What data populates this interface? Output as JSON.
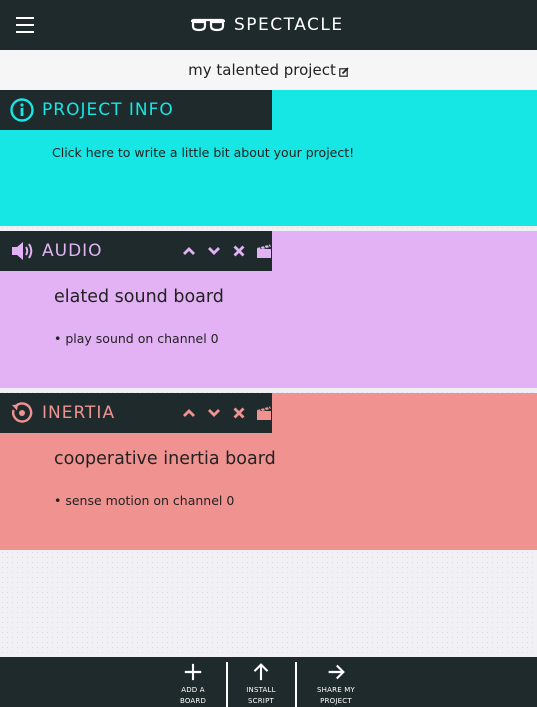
{
  "header": {
    "menu_icon": "hamburger-menu-icon",
    "logo_icon": "spectacles-logo-icon",
    "brand": "SPECTACLE"
  },
  "project": {
    "title": "my talented project",
    "edit_icon": "edit-pencil-icon"
  },
  "info": {
    "icon": "info-circle-icon",
    "title": "PROJECT INFO",
    "placeholder": "Click here to write a little bit about your project!"
  },
  "boards": [
    {
      "type": "AUDIO",
      "icon": "speaker-icon",
      "name": "elated sound board",
      "line": "• play sound on channel 0",
      "color": "#e2b2f4"
    },
    {
      "type": "INERTIA",
      "icon": "inertia-rotate-icon",
      "name": "cooperative inertia board",
      "line": "• sense motion on channel 0",
      "color": "#f09390"
    }
  ],
  "controls": {
    "icons": [
      "chevron-up-icon",
      "chevron-down-icon",
      "close-icon",
      "clapperboard-icon"
    ]
  },
  "footer": {
    "add": {
      "line1": "ADD A",
      "line2": "BOARD",
      "icon": "plus-icon"
    },
    "install": {
      "line1": "INSTALL",
      "line2": "SCRIPT",
      "icon": "arrow-up-icon"
    },
    "share": {
      "line1": "SHARE MY",
      "line2": "PROJECT",
      "icon": "arrow-right-icon"
    }
  },
  "colors": {
    "dark": "#1f2a2d",
    "info": "#16e6e4",
    "audio": "#e2b2f4",
    "inertia": "#f09390"
  }
}
